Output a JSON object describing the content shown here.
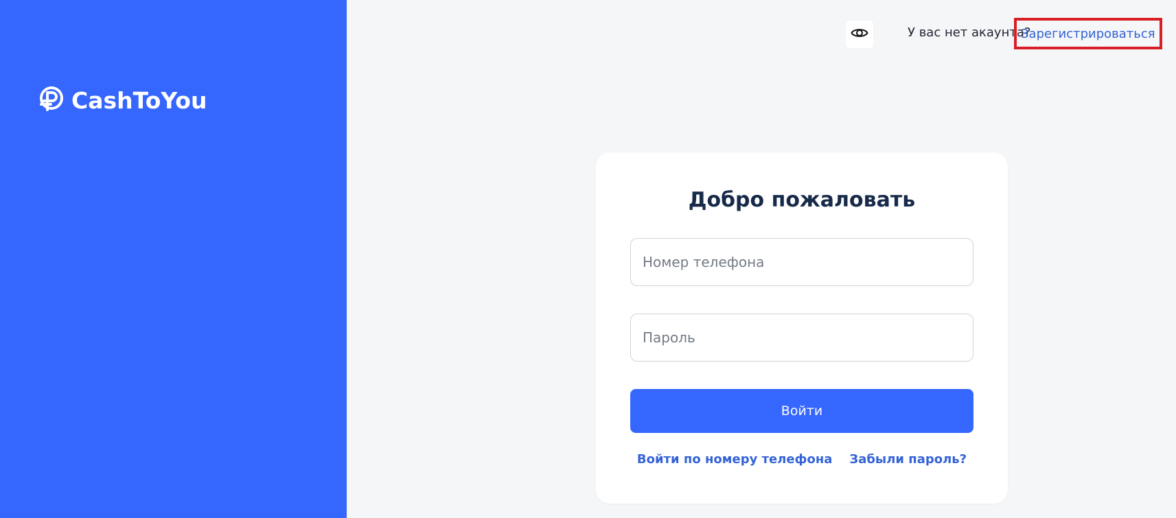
{
  "brand": {
    "name": "CashToYou",
    "logo_icon": "ruble-coin-icon"
  },
  "topbar": {
    "visibility_icon": "eye-icon",
    "no_account_text": "У вас нет акаунта?",
    "register_link": "Зарегистрироваться"
  },
  "login_form": {
    "title": "Добро пожаловать",
    "phone_placeholder": "Номер телефона",
    "password_placeholder": "Пароль",
    "submit_label": "Войти",
    "phone_login_link": "Войти по номеру телефона",
    "forgot_password_link": "Забыли пароль?"
  },
  "colors": {
    "primary": "#3566fe",
    "link": "#3463d6",
    "background": "#f5f6f8",
    "title": "#172a4a",
    "highlight_border": "#d81f26"
  }
}
